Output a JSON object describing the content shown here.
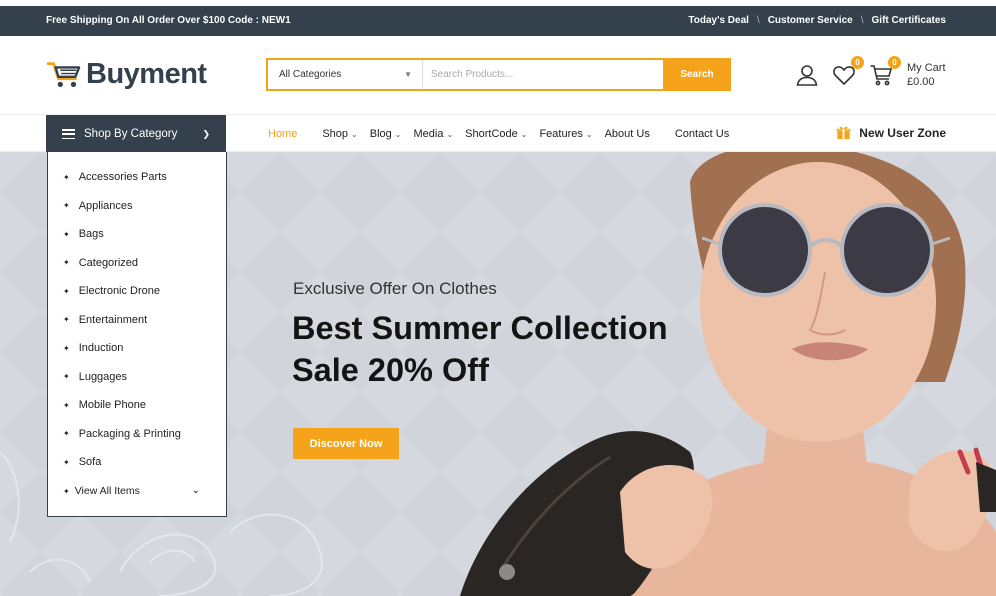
{
  "topbar": {
    "promo": "Free Shipping On All Order Over $100 Code : NEW1",
    "links": [
      "Today's Deal",
      "Customer Service",
      "Gift Certificates"
    ],
    "separator": "\\"
  },
  "brand": {
    "name": "Buyment",
    "logo_icon": "shopping-cart-logo-icon",
    "color": "#34404b"
  },
  "search": {
    "category_value": "All Categories",
    "placeholder": "Search Products...",
    "button_label": "Search"
  },
  "header_icons": {
    "account_icon": "user-icon",
    "wishlist_icon": "heart-icon",
    "wishlist_count": "0",
    "cart_icon": "cart-icon",
    "cart_count": "0",
    "cart_label": "My Cart",
    "cart_total": "£0.00"
  },
  "nav": {
    "category_button": "Shop By Category",
    "items": [
      {
        "label": "Home",
        "dropdown": false
      },
      {
        "label": "Shop",
        "dropdown": true
      },
      {
        "label": "Blog",
        "dropdown": true
      },
      {
        "label": "Media",
        "dropdown": true
      },
      {
        "label": "ShortCode",
        "dropdown": true
      },
      {
        "label": "Features",
        "dropdown": true
      },
      {
        "label": "About Us",
        "dropdown": false
      },
      {
        "label": "Contact Us",
        "dropdown": false
      }
    ],
    "new_user_zone": "New User Zone"
  },
  "categories": {
    "items": [
      "Accessories Parts",
      "Appliances",
      "Bags",
      "Categorized",
      "Electronic Drone",
      "Entertainment",
      "Induction",
      "Luggages",
      "Mobile Phone",
      "Packaging & Printing",
      "Sofa"
    ],
    "view_all": "View All Items"
  },
  "hero": {
    "kicker": "Exclusive Offer On Clothes",
    "headline_line1": "Best Summer Collection",
    "headline_line2": "Sale 20% Off",
    "cta": "Discover Now"
  },
  "colors": {
    "accent": "#f5a31a",
    "dark": "#34404b",
    "hero_bg": "#d5d8de"
  }
}
